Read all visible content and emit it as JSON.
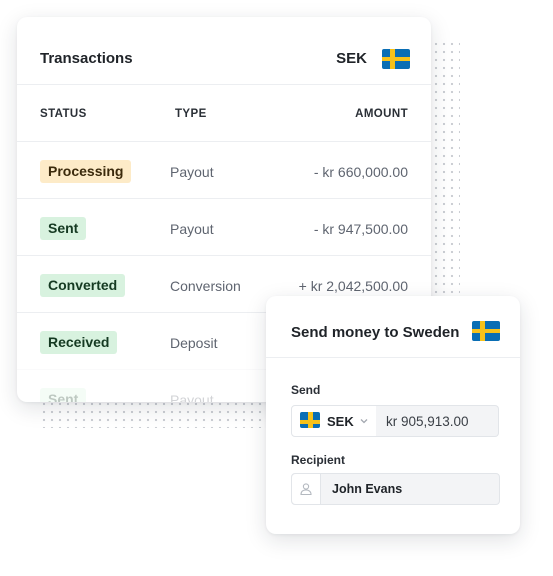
{
  "transactions": {
    "title": "Transactions",
    "currency": "SEK",
    "columns": {
      "status": "STATUS",
      "type": "TYPE",
      "amount": "AMOUNT"
    },
    "rows": [
      {
        "status": "Processing",
        "type": "Payout",
        "amount": "- kr 660,000.00"
      },
      {
        "status": "Sent",
        "type": "Payout",
        "amount": "- kr 947,500.00"
      },
      {
        "status": "Converted",
        "type": "Conversion",
        "amount": "+ kr 2,042,500.00"
      },
      {
        "status": "Received",
        "type": "Deposit",
        "amount": ""
      },
      {
        "status": "Sent",
        "type": "Payout",
        "amount": ""
      }
    ]
  },
  "send": {
    "title": "Send money to Sweden",
    "send_label": "Send",
    "currency": "SEK",
    "amount": "kr 905,913.00",
    "recipient_label": "Recipient",
    "recipient_name": "John Evans"
  },
  "icons": {
    "flag": "sweden-flag-icon",
    "chevron": "chevron-down-icon",
    "person": "person-icon"
  },
  "colors": {
    "processing_badge": "#fdebc8",
    "success_badge": "#d8f2df",
    "flag_blue": "#0a6eb4",
    "flag_yellow": "#f7c21a"
  }
}
